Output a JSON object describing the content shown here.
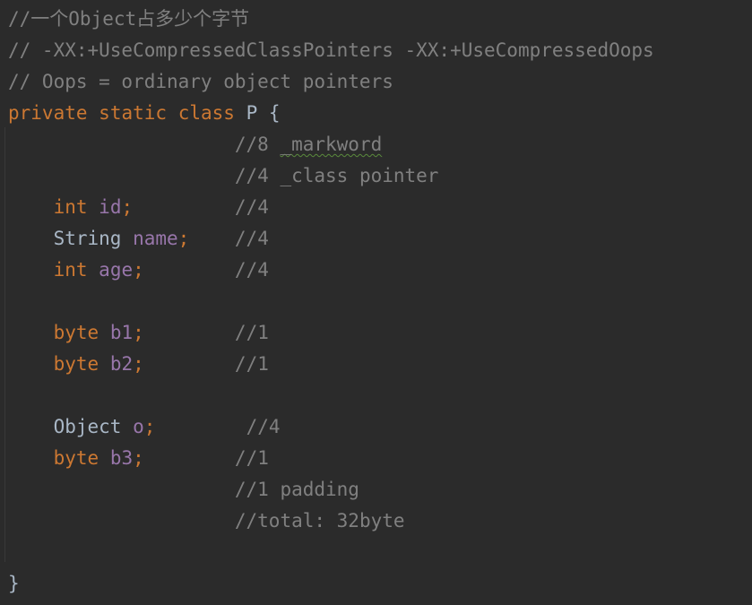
{
  "comments": {
    "title": "//一个Object占多少个字节",
    "jvm_flags": "// -XX:+UseCompressedClassPointers -XX:+UseCompressedOops",
    "oops": "// Oops = ordinary object pointers"
  },
  "class_decl": {
    "private": "private",
    "static": "static",
    "class": "class",
    "name": "P",
    "open_brace": "{",
    "close_brace": "}"
  },
  "header": {
    "markword_prefix": "//8 ",
    "markword_word": "_markword",
    "class_pointer": "//4 _class pointer"
  },
  "fields": [
    {
      "type": "int",
      "name": "id",
      "semi": ";",
      "comment": "//4"
    },
    {
      "type": "String",
      "name": "name",
      "semi": ";",
      "comment": "//4"
    },
    {
      "type": "int",
      "name": "age",
      "semi": ";",
      "comment": "//4"
    },
    {
      "type": "byte",
      "name": "b1",
      "semi": ";",
      "comment": "//1"
    },
    {
      "type": "byte",
      "name": "b2",
      "semi": ";",
      "comment": "//1"
    },
    {
      "type": "Object",
      "name": "o",
      "semi": ";",
      "comment": "//4"
    },
    {
      "type": "byte",
      "name": "b3",
      "semi": ";",
      "comment": "//1"
    }
  ],
  "footer": {
    "padding": "//1 padding",
    "total": "//total: 32byte"
  },
  "colors": {
    "background": "#2b2b2b",
    "keyword": "#cc7832",
    "comment": "#808080",
    "field": "#9876aa",
    "text": "#a9b7c6"
  }
}
